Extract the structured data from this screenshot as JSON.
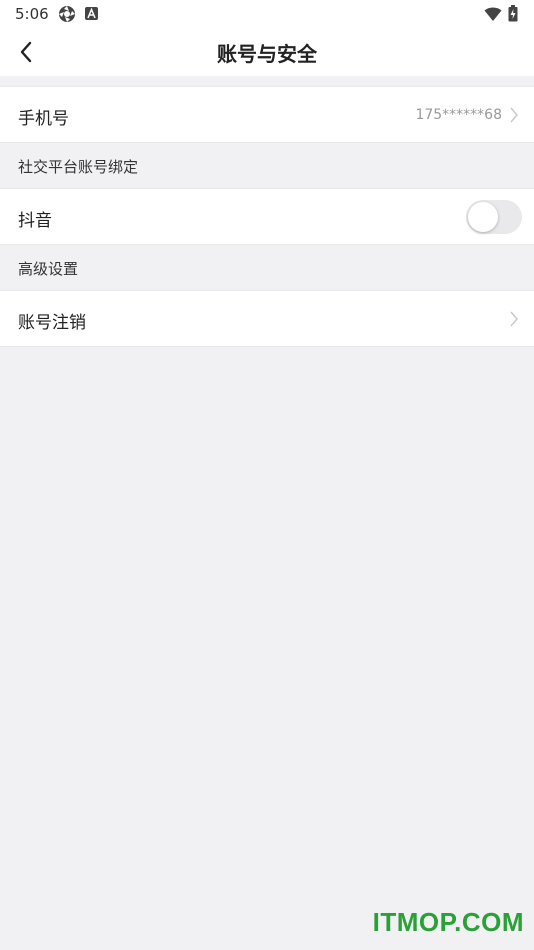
{
  "status_bar": {
    "time": "5:06",
    "icons": [
      "aperture-icon",
      "a-app-icon",
      "wifi-icon",
      "battery-icon"
    ]
  },
  "header": {
    "title": "账号与安全",
    "back_icon": "chevron-left-icon"
  },
  "rows": {
    "phone": {
      "label": "手机号",
      "value": "175******68"
    },
    "douyin": {
      "label": "抖音",
      "toggle_on": false
    },
    "deregister": {
      "label": "账号注销"
    }
  },
  "sections": {
    "social": "社交平台账号绑定",
    "advanced": "高级设置"
  },
  "watermark": "ITMOP.COM",
  "colors": {
    "background": "#f1f1f3",
    "card": "#ffffff",
    "watermark": "#2aa137",
    "toggle_off": "#e9e9eb"
  }
}
